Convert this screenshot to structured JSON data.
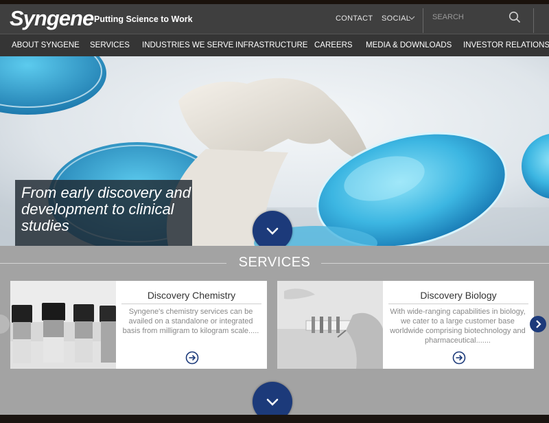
{
  "header": {
    "logo": "Syngene",
    "tagline": "Putting Science to Work",
    "contact": "CONTACT",
    "social": "SOCIAL",
    "search_placeholder": "SEARCH"
  },
  "nav": {
    "items": [
      "ABOUT SYNGENE",
      "SERVICES",
      "INDUSTRIES WE SERVE",
      "INFRASTRUCTURE",
      "CAREERS",
      "MEDIA & DOWNLOADS",
      "INVESTOR RELATIONS"
    ]
  },
  "hero": {
    "caption": "From early discovery and development to clinical studies"
  },
  "services": {
    "title": "SERVICES",
    "cards": [
      {
        "title": "Discovery Chemistry",
        "description": "Syngene's chemistry services can be availed on a standalone or integrated basis from milligram to kilogram scale.....",
        "image_icon": "vials-photo"
      },
      {
        "title": "Discovery Biology",
        "description": "With wide-ranging capabilities in biology, we cater to a large customer base worldwide comprising biotechnology and pharmaceutical.......",
        "image_icon": "glove-tubes-photo"
      }
    ]
  },
  "colors": {
    "header_bg": "#3f3f3f",
    "nav_bg": "#353535",
    "services_bg": "#a3a3a3",
    "accent_blue": "#1c3a7a",
    "petri_cyan": "#2aa9d8"
  }
}
